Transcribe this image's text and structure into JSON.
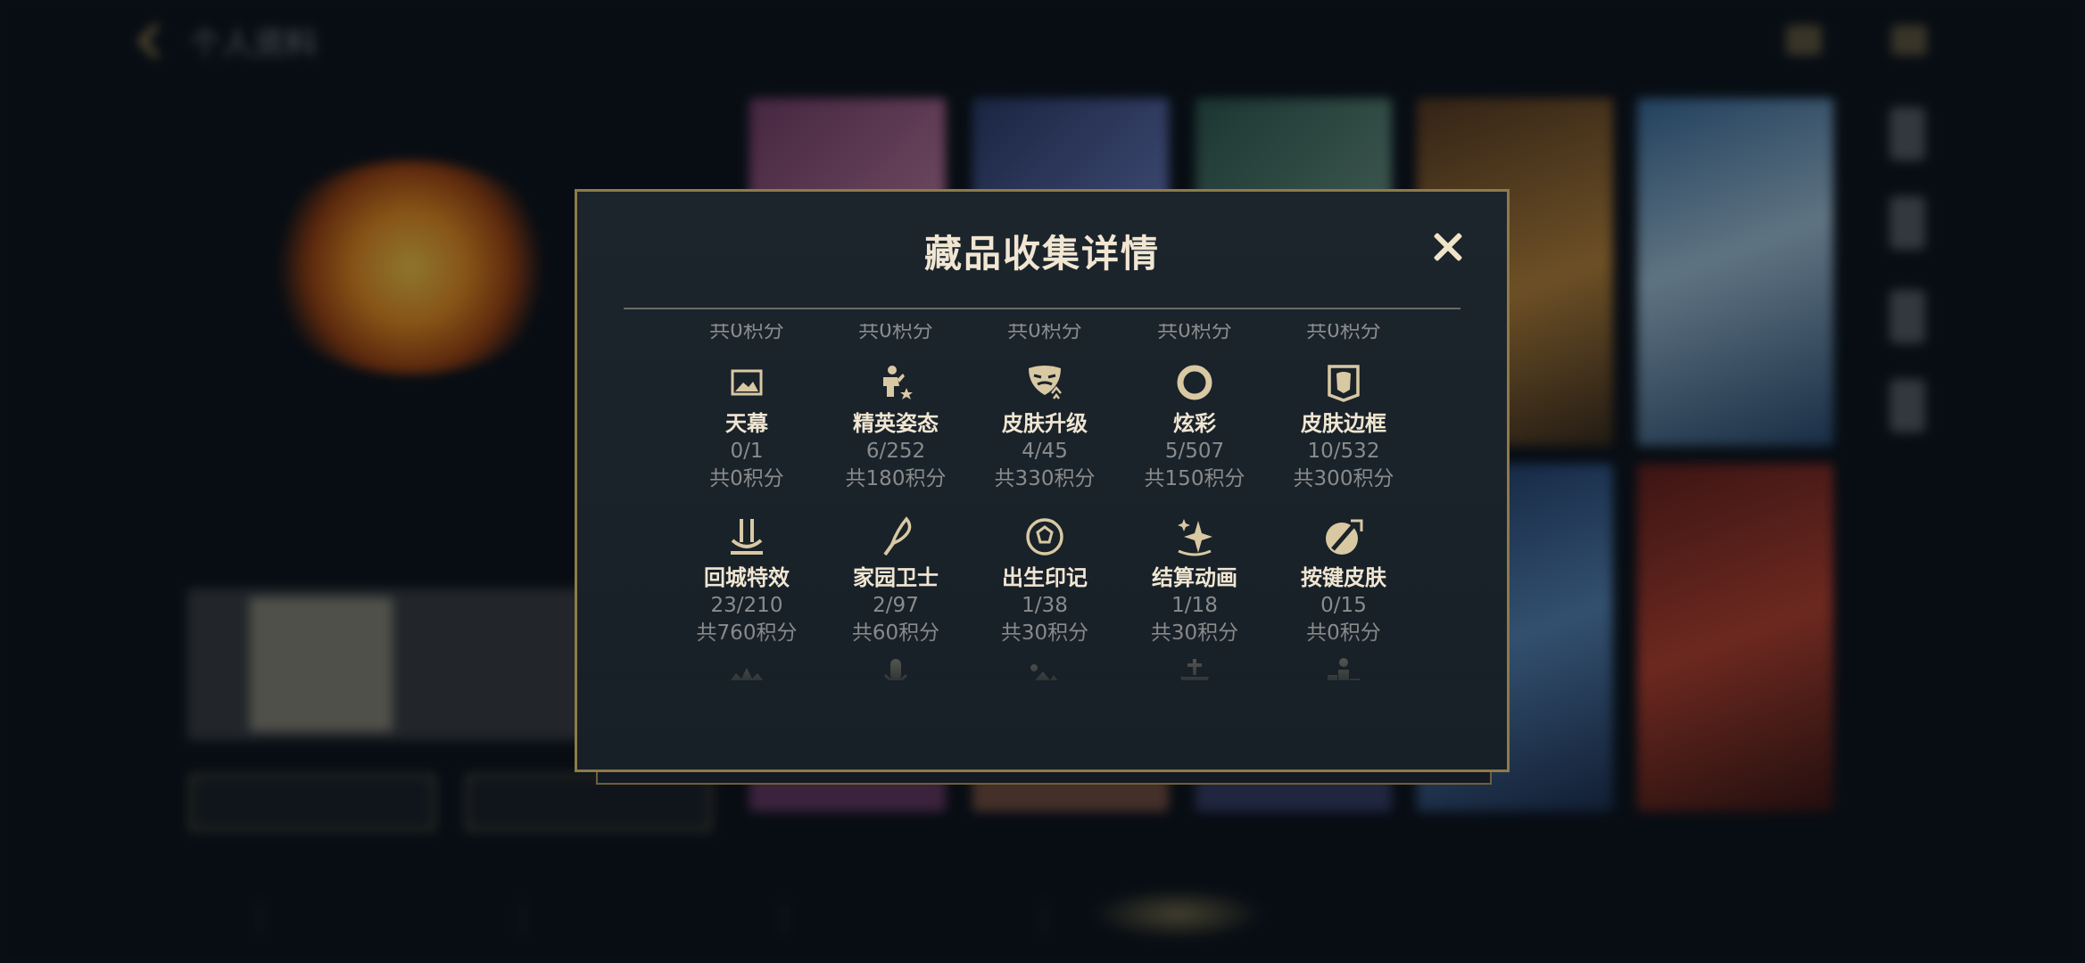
{
  "header": {
    "title": "个人资料"
  },
  "modal": {
    "title": "藏品收集详情",
    "close_icon": "close-icon",
    "top_cut_points": [
      "共0积分",
      "共0积分",
      "共0积分",
      "共0积分",
      "共0积分"
    ],
    "rows": [
      [
        {
          "name": "天幕",
          "count": "0/1",
          "points": "共0积分",
          "icon": "image-frame-icon"
        },
        {
          "name": "精英姿态",
          "count": "6/252",
          "points": "共180积分",
          "icon": "elite-pose-icon"
        },
        {
          "name": "皮肤升级",
          "count": "4/45",
          "points": "共330积分",
          "icon": "mask-upgrade-icon"
        },
        {
          "name": "炫彩",
          "count": "5/507",
          "points": "共150积分",
          "icon": "ring-icon"
        },
        {
          "name": "皮肤边框",
          "count": "10/532",
          "points": "共300积分",
          "icon": "portrait-frame-icon"
        }
      ],
      [
        {
          "name": "回城特效",
          "count": "23/210",
          "points": "共760积分",
          "icon": "recall-effect-icon"
        },
        {
          "name": "家园卫士",
          "count": "2/97",
          "points": "共60积分",
          "icon": "quill-icon"
        },
        {
          "name": "出生印记",
          "count": "1/38",
          "points": "共30积分",
          "icon": "birth-mark-icon"
        },
        {
          "name": "结算动画",
          "count": "1/18",
          "points": "共30积分",
          "icon": "sparkle-icon"
        },
        {
          "name": "按键皮肤",
          "count": "0/15",
          "points": "共0积分",
          "icon": "sword-badge-icon"
        }
      ]
    ],
    "next_row_icons": [
      "crown-icon",
      "microphone-icon",
      "landscape-icon",
      "pedestal-icon",
      "podium-icon"
    ]
  },
  "colors": {
    "gold": "#c8aa6e",
    "modal_bg": "#1a222a",
    "text_title": "#f0e6d2",
    "text_sub": "#8a8c8c"
  }
}
